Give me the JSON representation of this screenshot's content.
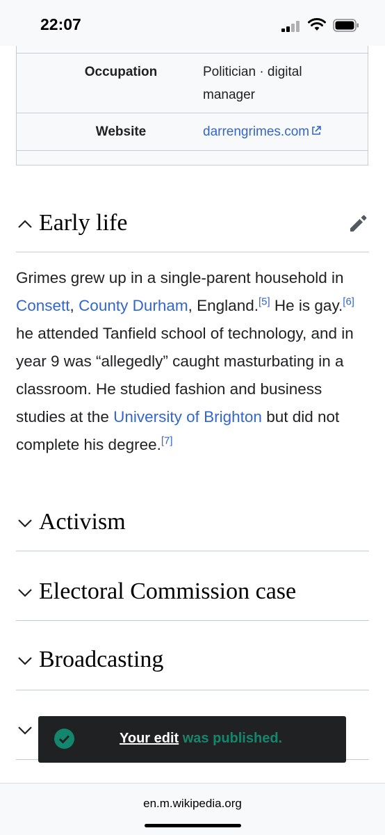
{
  "status_bar": {
    "time": "22:07"
  },
  "infobox": {
    "rows": [
      {
        "label": "Occupation",
        "value_line1": "Politician · digital",
        "value_line2": "manager"
      },
      {
        "label": "Website",
        "link": "darrengrimes.com"
      }
    ]
  },
  "sections": [
    {
      "title": "Early life",
      "expanded": true
    },
    {
      "title": "Activism",
      "expanded": false
    },
    {
      "title": "Electoral Commission case",
      "expanded": false
    },
    {
      "title": "Broadcasting",
      "expanded": false
    }
  ],
  "early_life": {
    "t1": "Grimes grew up in a single-parent household in ",
    "link_consett": "Consett",
    "t2": ", ",
    "link_county_durham": "County Durham",
    "t3": ", England.",
    "ref5": "[5]",
    "t4": " He is gay.",
    "ref6": "[6]",
    "t5": " he attended Tanfield school of technology, and in year 9 was “allegedly” caught masturbating in a classroom. He studied fashion and business studies at the ",
    "link_brighton": "University of Brighton",
    "t6": " but did not complete his degree.",
    "ref7": "[7]"
  },
  "toast": {
    "link_text": "Your edit",
    "rest_text": " was published."
  },
  "url_bar": {
    "url": "en.m.wikipedia.org"
  },
  "colors": {
    "link": "#3366cc",
    "success": "#14866d",
    "toast_bg": "#202122"
  }
}
